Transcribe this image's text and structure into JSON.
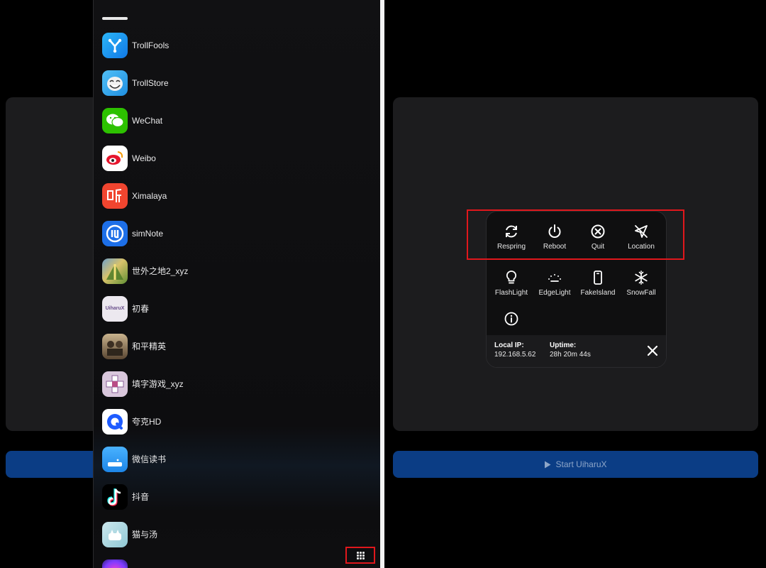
{
  "left_pane": {
    "apps": [
      {
        "name": "TrollFools",
        "icon": "trollfools-icon",
        "color": "#1aa3f5"
      },
      {
        "name": "TrollStore",
        "icon": "trollstore-icon",
        "color": "#2fa6f2"
      },
      {
        "name": "WeChat",
        "icon": "wechat-icon",
        "color": "#2dc100"
      },
      {
        "name": "Weibo",
        "icon": "weibo-icon",
        "color": "#ffffff"
      },
      {
        "name": "Ximalaya",
        "icon": "ximalaya-icon",
        "color": "#f0452f"
      },
      {
        "name": "simNote",
        "icon": "simnote-icon",
        "color": "#1d6fe8"
      },
      {
        "name": "世外之地2_xyz",
        "icon": "game-icon",
        "color": "#7aa33a"
      },
      {
        "name": "初春",
        "icon": "uiharux-icon",
        "color": "#eae6ee"
      },
      {
        "name": "和平精英",
        "icon": "pubg-icon",
        "color": "#8a6c4a"
      },
      {
        "name": "填字游戏_xyz",
        "icon": "crossword-icon",
        "color": "#d6c2d9"
      },
      {
        "name": "夸克HD",
        "icon": "quark-icon",
        "color": "#ffffff"
      },
      {
        "name": "微信读书",
        "icon": "wechat-read-icon",
        "color": "#2d9af0"
      },
      {
        "name": "抖音",
        "icon": "douyin-icon",
        "color": "#000000"
      },
      {
        "name": "猫与汤",
        "icon": "cat-soup-icon",
        "color": "#b7dfe6"
      },
      {
        "name": "",
        "icon": "partial-app-icon",
        "color": "#7d3cff"
      }
    ],
    "grid_toggle_icon": "grid-icon"
  },
  "right_pane": {
    "actions_row1": [
      {
        "label": "Respring",
        "icon": "respring-icon"
      },
      {
        "label": "Reboot",
        "icon": "power-icon"
      },
      {
        "label": "Quit",
        "icon": "quit-icon"
      },
      {
        "label": "Location",
        "icon": "location-off-icon"
      }
    ],
    "actions_row2": [
      {
        "label": "FlashLight",
        "icon": "flashlight-icon"
      },
      {
        "label": "EdgeLight",
        "icon": "edgelight-icon"
      },
      {
        "label": "FakeIsland",
        "icon": "phone-icon"
      },
      {
        "label": "SnowFall",
        "icon": "snowflake-icon"
      }
    ],
    "info_icon": "info-icon",
    "footer": {
      "local_ip_label": "Local IP:",
      "local_ip_value": "192.168.5.62",
      "uptime_label": "Uptime:",
      "uptime_value": "28h 20m 44s"
    },
    "start_button": {
      "label": "Start UiharuX",
      "icon": "play-icon"
    }
  },
  "colors": {
    "highlight": "#e0171c",
    "start_button": "#0b3d85",
    "card_bg": "#1c1c1e"
  }
}
